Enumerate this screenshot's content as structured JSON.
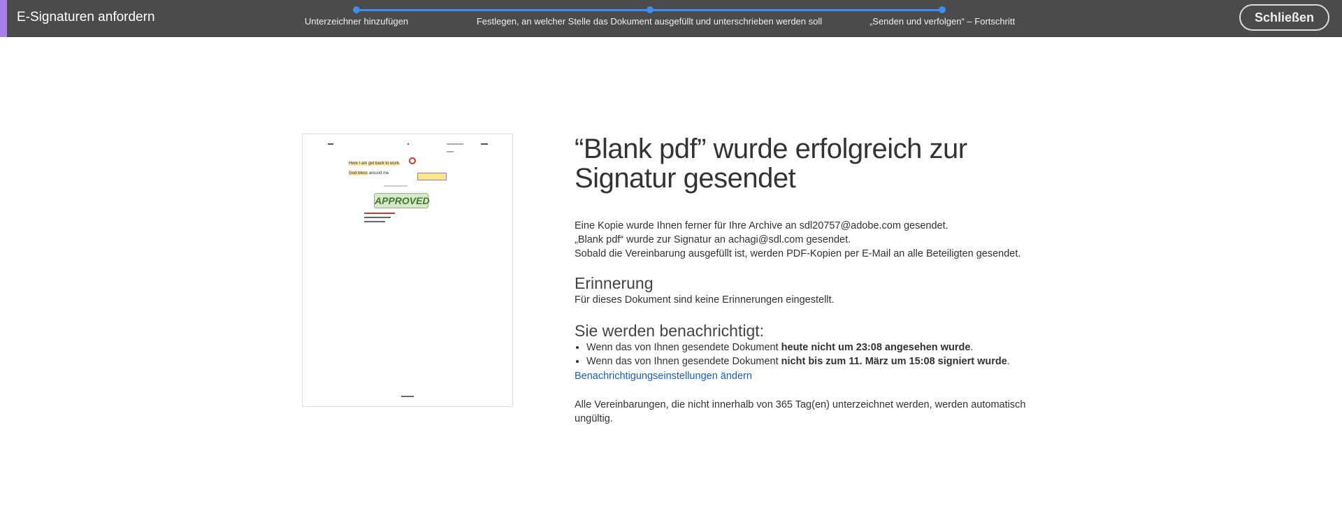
{
  "header": {
    "title": "E-Signaturen anfordern",
    "steps": [
      "Unterzeichner hinzufügen",
      "Festlegen, an welcher Stelle das Dokument ausgefüllt und unterschrieben werden soll",
      "„Senden und verfolgen“ – Fortschritt"
    ],
    "close_label": "Schließen",
    "accent": "#3d8ef0"
  },
  "thumbnail": {
    "stamp": "APPROVED",
    "line1a": "Here I am",
    "line1b": "get back to work.",
    "line2a": "God bless",
    "line2b": "around me"
  },
  "main": {
    "heading": "“Blank pdf” wurde erfolgreich zur Signatur gesendet",
    "info": [
      "Eine Kopie wurde Ihnen ferner für Ihre Archive an sdl20757@adobe.com gesendet.",
      "„Blank pdf“ wurde zur Signatur an achagi@sdl.com gesendet.",
      "Sobald die Vereinbarung ausgefüllt ist, werden PDF-Kopien per E-Mail an alle Beteiligten gesendet."
    ],
    "reminder_title": "Erinnerung",
    "reminder_text": "Für dieses Dokument sind keine Erinnerungen eingestellt.",
    "notify_title": "Sie werden benachrichtigt:",
    "notify": [
      {
        "prefix": "Wenn das von Ihnen gesendete Dokument ",
        "bold": "heute nicht um 23:08 angesehen wurde",
        "suffix": "."
      },
      {
        "prefix": "Wenn das von Ihnen gesendete Dokument ",
        "bold": "nicht bis zum 11. März um 15:08 signiert wurde",
        "suffix": "."
      }
    ],
    "settings_link": "Benachrichtigungseinstellungen ändern",
    "expiry": "Alle Vereinbarungen, die nicht innerhalb von 365 Tag(en) unterzeichnet werden, werden automatisch ungültig."
  }
}
